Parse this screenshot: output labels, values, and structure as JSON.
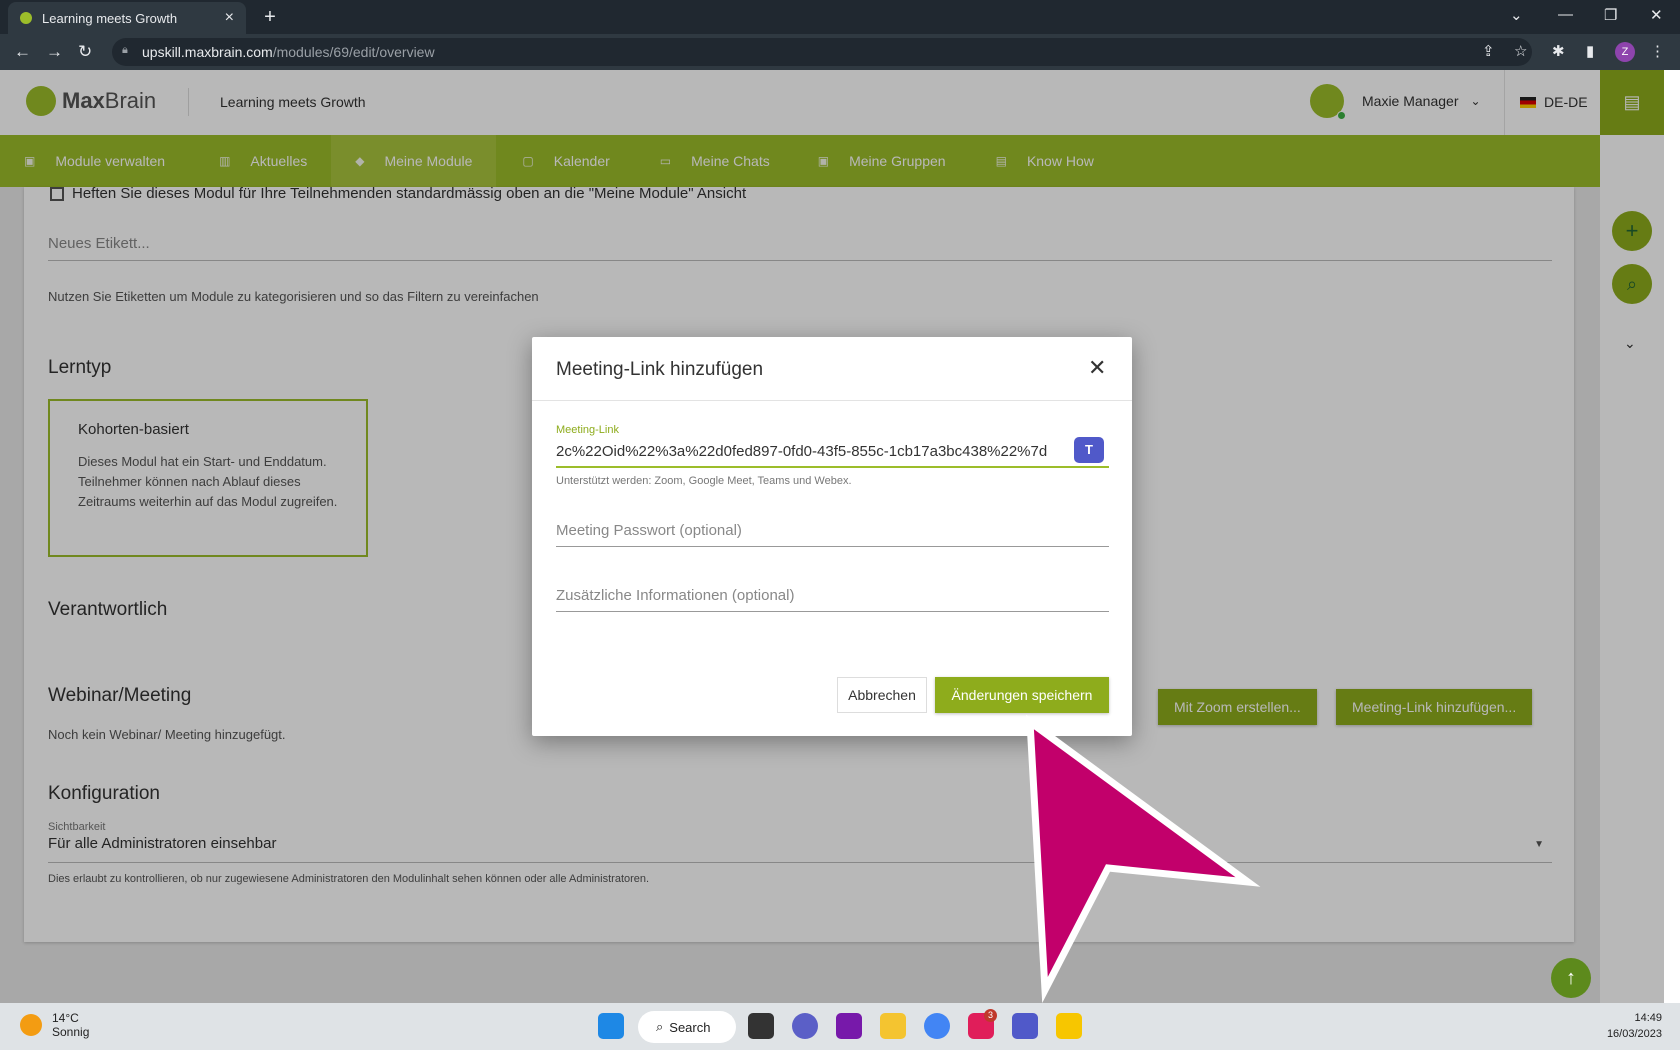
{
  "browser": {
    "tab_title": "Learning meets Growth",
    "url_host": "upskill.maxbrain.com",
    "url_path": "/modules/69/edit/overview",
    "profile_initial": "Z"
  },
  "header": {
    "logo_bold": "Max",
    "logo_light": "Brain",
    "tagline": "Learning meets Growth",
    "user_name": "Maxie Manager",
    "language": "DE-DE"
  },
  "nav": {
    "items": [
      {
        "label": "Module verwalten"
      },
      {
        "label": "Aktuelles"
      },
      {
        "label": "Meine Module"
      },
      {
        "label": "Kalender"
      },
      {
        "label": "Meine Chats"
      },
      {
        "label": "Meine Gruppen"
      },
      {
        "label": "Know How"
      }
    ]
  },
  "content": {
    "pin_checkbox_label": "Heften Sie dieses Modul für Ihre Teilnehmenden standardmässig oben an die \"Meine Module\" Ansicht",
    "tag_placeholder": "Neues Etikett...",
    "tag_hint": "Nutzen Sie Etiketten um Module zu kategorisieren und so das Filtern zu vereinfachen",
    "lerntyp_title": "Lerntyp",
    "learn_type_title": "Kohorten-basiert",
    "learn_type_desc": "Dieses Modul hat ein Start- und Enddatum. Teilnehmer können nach Ablauf dieses Zeitraums weiterhin auf das Modul zugreifen.",
    "responsible_title": "Verantwortlich",
    "webinar_title": "Webinar/Meeting",
    "no_webinar": "Noch kein Webinar/ Meeting hinzugefügt.",
    "zoom_button": "Mit Zoom erstellen...",
    "meeting_link_button": "Meeting-Link hinzufügen...",
    "config_title": "Konfiguration",
    "visibility_label": "Sichtbarkeit",
    "visibility_value": "Für alle Administratoren einsehbar",
    "visibility_hint": "Dies erlaubt zu kontrollieren, ob nur zugewiesene Administratoren den Modulinhalt sehen können oder alle Administratoren."
  },
  "modal": {
    "title": "Meeting-Link hinzufügen",
    "link_label": "Meeting-Link",
    "link_value": "2c%22Oid%22%3a%22d0fed897-0fd0-43f5-855c-1cb17a3bc438%22%7d",
    "supported": "Unterstützt werden: Zoom, Google Meet, Teams und Webex.",
    "password_placeholder": "Meeting Passwort (optional)",
    "info_placeholder": "Zusätzliche Informationen (optional)",
    "cancel": "Abbrechen",
    "save": "Änderungen speichern"
  },
  "taskbar": {
    "temperature": "14°C",
    "weather": "Sonnig",
    "search": "Search",
    "time": "14:49",
    "date": "16/03/2023",
    "slack_badge": "3"
  },
  "colors": {
    "brand_green": "#9cbd2a",
    "button_green": "#8eac1c",
    "pointer_magenta": "#c2006b"
  }
}
